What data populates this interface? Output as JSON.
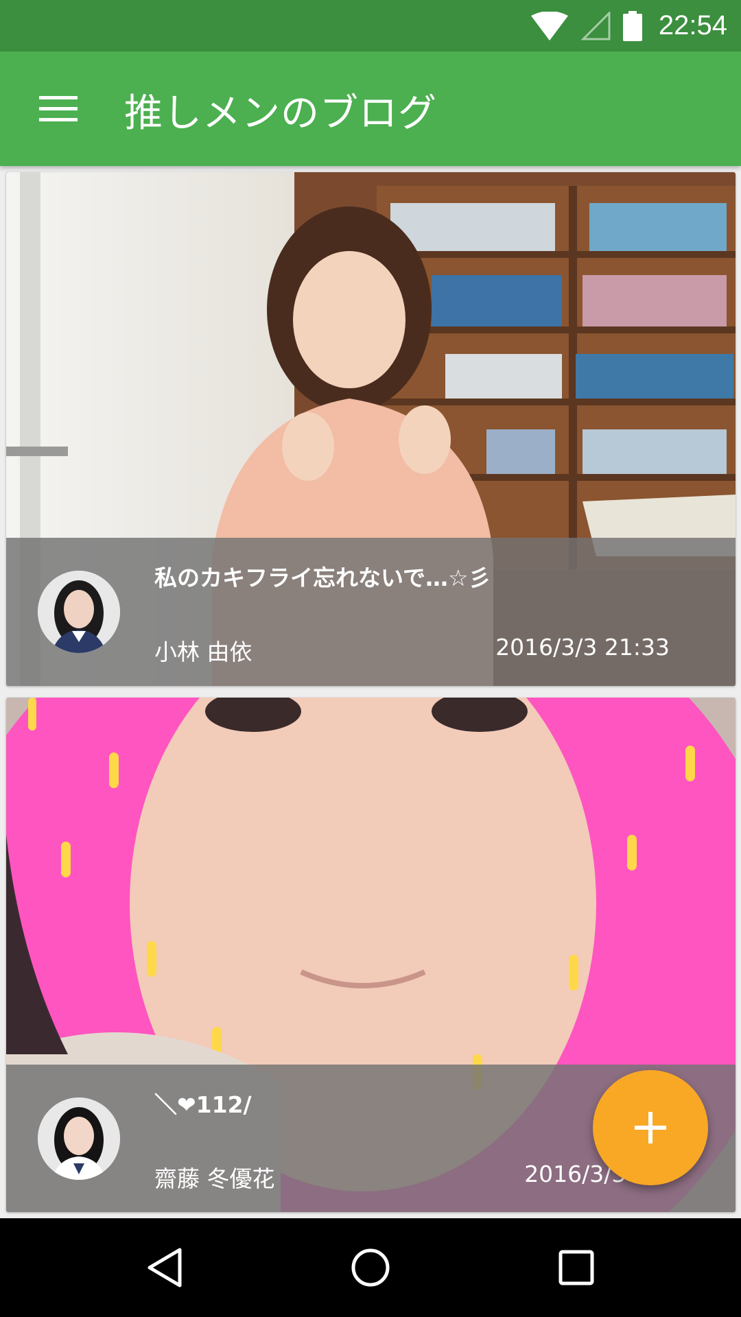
{
  "status_bar": {
    "time": "22:54",
    "icons": [
      "wifi-icon",
      "cell-signal-icon",
      "battery-icon"
    ]
  },
  "toolbar": {
    "title": "推しメンのブログ",
    "menu_icon": "hamburger-menu-icon"
  },
  "colors": {
    "status_bar": "#3b8f3e",
    "toolbar": "#4caf50",
    "fab": "#f9a825",
    "overlay": "#737373"
  },
  "posts": [
    {
      "title": "私のカキフライ忘れないで…☆彡",
      "author": "小林 由依",
      "date": "2016/3/3  21:33",
      "image": "photo of a girl making peace signs in a library"
    },
    {
      "title": "＼❤112/",
      "author": "齋藤 冬優花",
      "date": "2016/3/3  21:",
      "image": "close-up selfie with pink donut frame"
    }
  ],
  "fab": {
    "icon": "plus-icon"
  },
  "nav_bar": {
    "icons": [
      "back-icon",
      "home-icon",
      "recents-icon"
    ]
  }
}
